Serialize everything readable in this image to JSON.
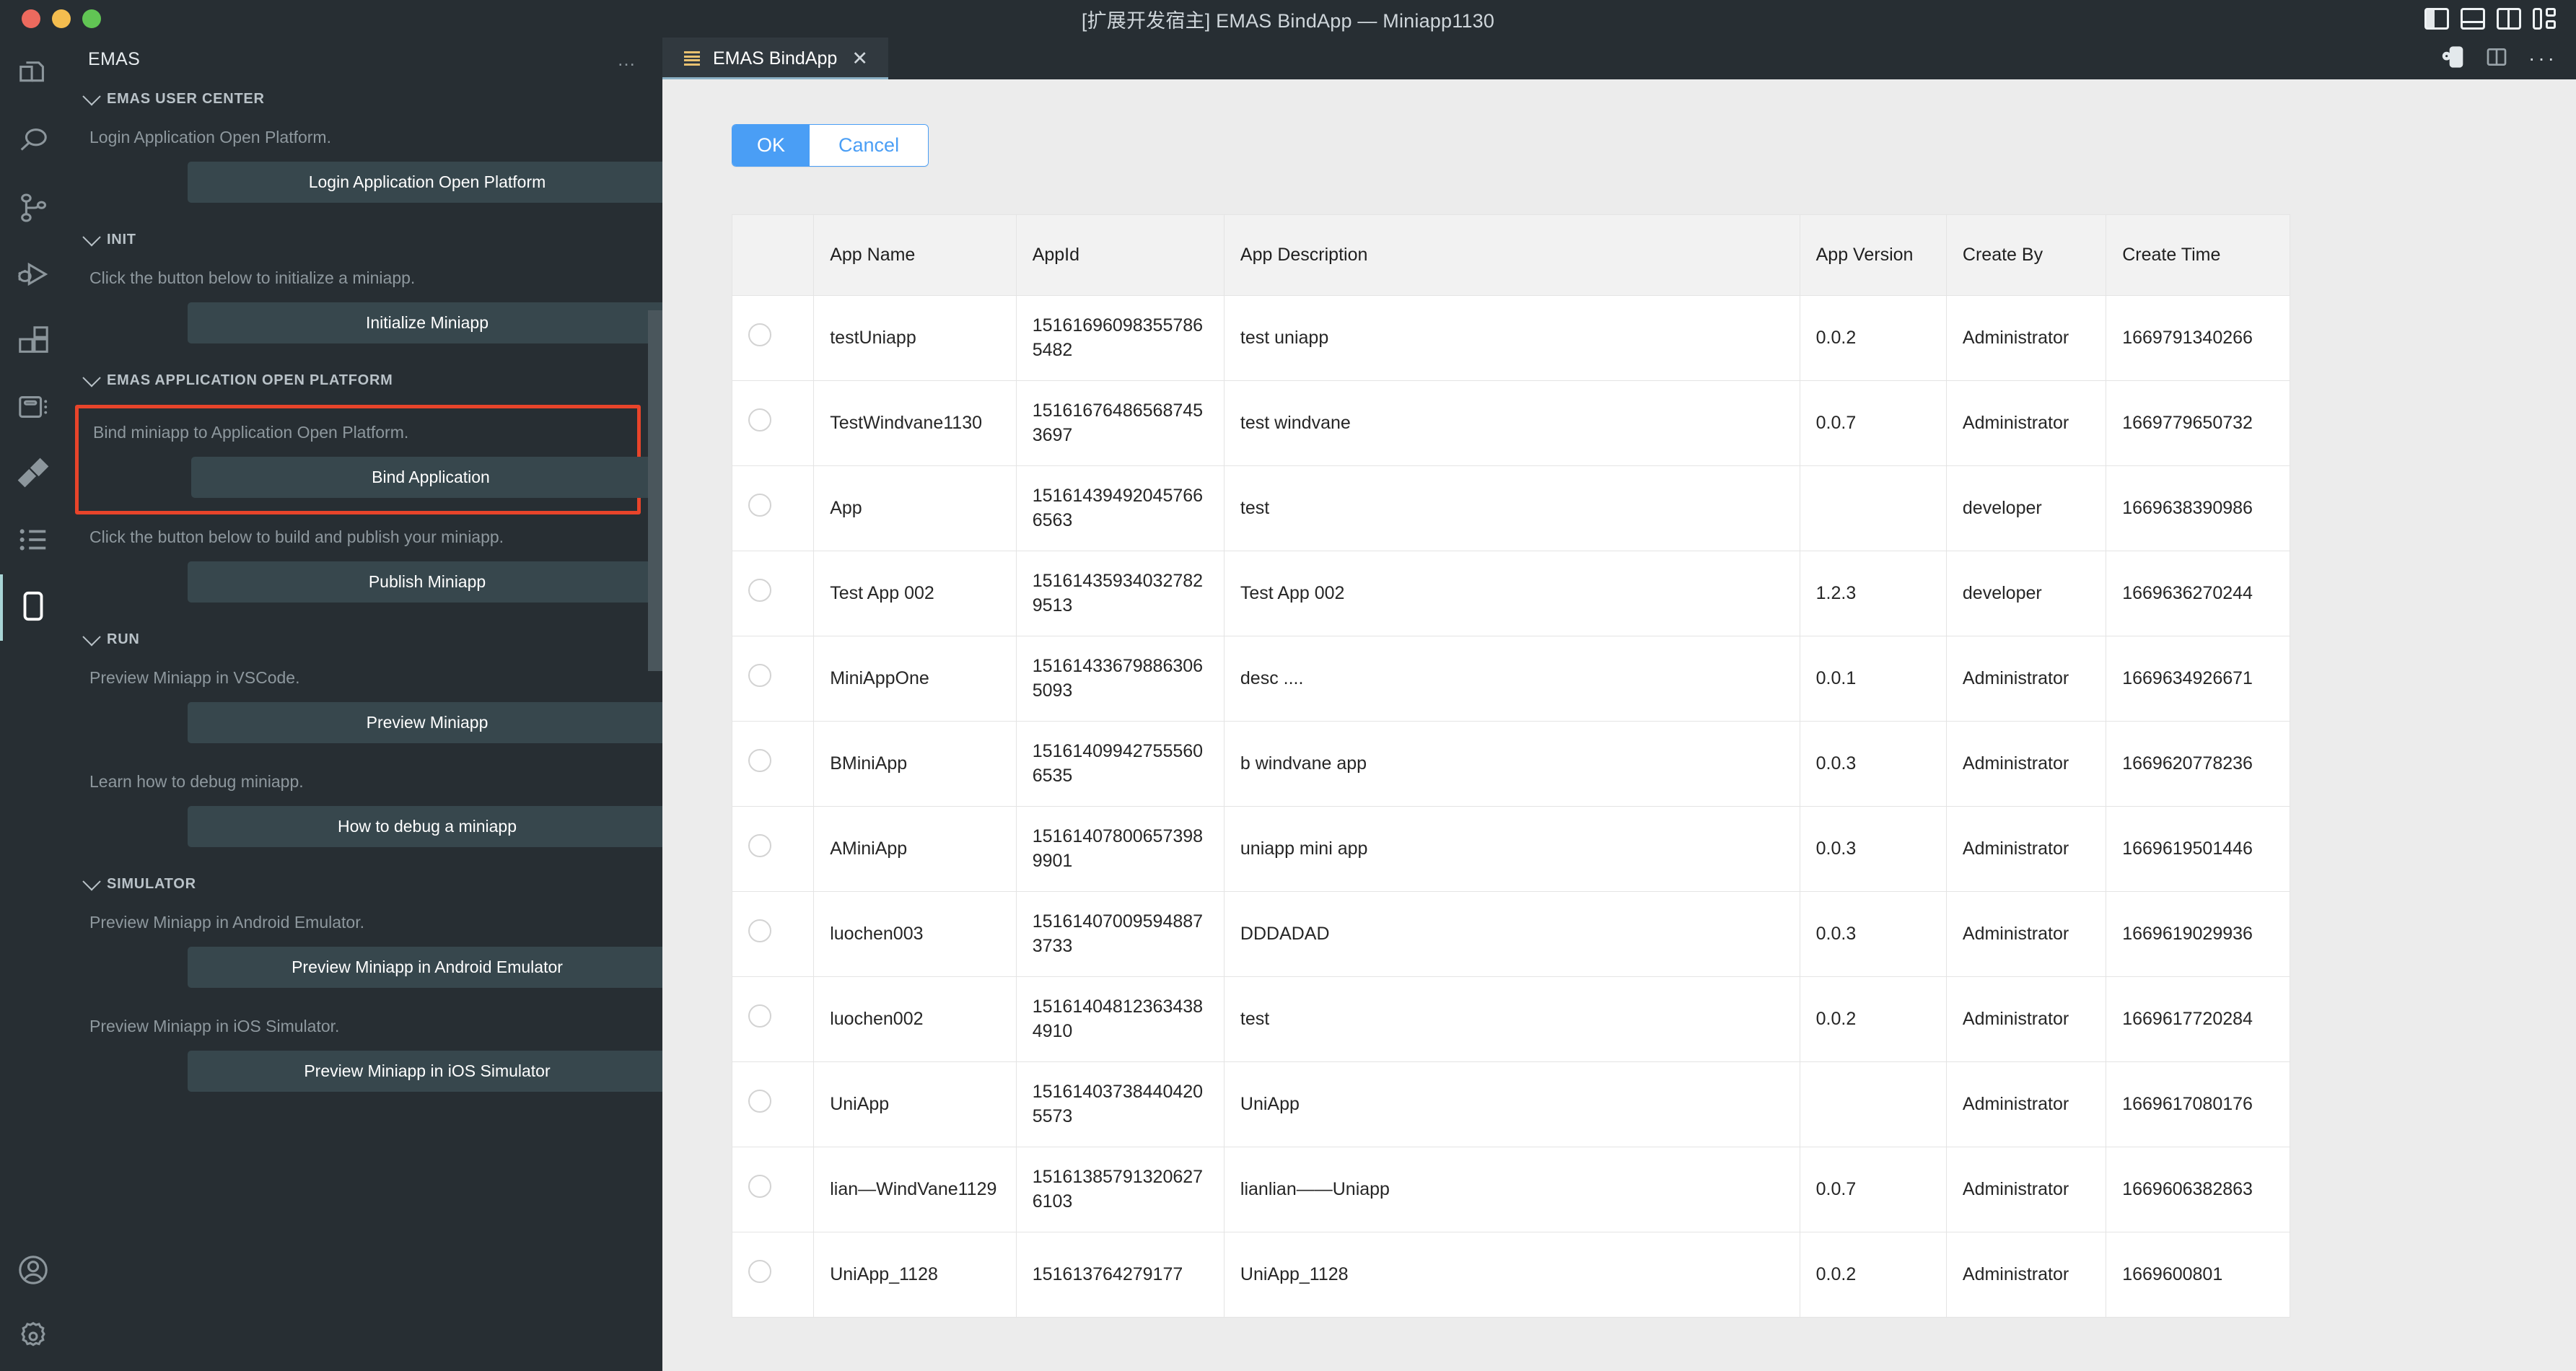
{
  "titlebar": {
    "window_title": "[扩展开发宿主] EMAS BindApp — Miniapp1130",
    "layout_icons": [
      "toggle-primary-sidebar",
      "toggle-panel",
      "toggle-secondary-sidebar",
      "customize-layout"
    ]
  },
  "activity_bar": {
    "items": [
      {
        "name": "explorer",
        "active": false
      },
      {
        "name": "search",
        "active": false
      },
      {
        "name": "source-control",
        "active": false
      },
      {
        "name": "run-and-debug",
        "active": false
      },
      {
        "name": "extensions",
        "active": false
      },
      {
        "name": "remote-explorer",
        "active": false
      },
      {
        "name": "tools",
        "active": false
      },
      {
        "name": "task-list",
        "active": false
      },
      {
        "name": "miniapp-device",
        "active": true
      }
    ],
    "bottom_items": [
      {
        "name": "accounts",
        "active": false
      },
      {
        "name": "manage-settings",
        "active": false
      }
    ]
  },
  "sidebar": {
    "title": "EMAS",
    "more_actions": "…",
    "sections": [
      {
        "header": "EMAS USER CENTER",
        "description": "Login Application Open Platform.",
        "button": "Login Application Open Platform",
        "highlighted": false
      },
      {
        "header": "INIT",
        "description": "Click the button below to initialize a miniapp.",
        "button": "Initialize Miniapp",
        "highlighted": false
      },
      {
        "header": "EMAS APPLICATION OPEN PLATFORM",
        "description": "Bind miniapp to Application Open Platform.",
        "button": "Bind Application",
        "highlighted": true,
        "highlight_color": "#e8442a",
        "extra_description": "Click the button below to build and publish your miniapp.",
        "extra_button": "Publish Miniapp"
      },
      {
        "header": "RUN",
        "description": "Preview Miniapp in VSCode.",
        "button": "Preview Miniapp",
        "highlighted": false,
        "extra_description": "Learn how to debug miniapp.",
        "extra_button": "How to debug a miniapp"
      },
      {
        "header": "SIMULATOR",
        "description": "Preview Miniapp in Android Emulator.",
        "button": "Preview Miniapp in Android Emulator",
        "highlighted": false,
        "extra_description": "Preview Miniapp in iOS Simulator.",
        "extra_button": "Preview Miniapp in iOS Simulator"
      }
    ]
  },
  "editor": {
    "tab": {
      "label": "EMAS BindApp",
      "close": "✕",
      "icon": "list-icon"
    },
    "actions": [
      "device-settings-icon",
      "split-editor-icon",
      "more-actions-icon"
    ]
  },
  "dialog": {
    "ok_label": "OK",
    "cancel_label": "Cancel",
    "accent_color": "#4a9ef5",
    "table": {
      "columns": [
        "",
        "App Name",
        "AppId",
        "App Description",
        "App Version",
        "Create By",
        "Create Time"
      ],
      "rows": [
        {
          "selected": false,
          "app_name": "testUniapp",
          "app_id": "151616960983557865482",
          "app_description": "test uniapp",
          "app_version": "0.0.2",
          "create_by": "Administrator",
          "create_time": "1669791340266"
        },
        {
          "selected": false,
          "app_name": "TestWindvane1130",
          "app_id": "151616764865687453697",
          "app_description": "test windvane",
          "app_version": "0.0.7",
          "create_by": "Administrator",
          "create_time": "1669779650732"
        },
        {
          "selected": false,
          "app_name": "App",
          "app_id": "151614394920457666563",
          "app_description": "test",
          "app_version": "",
          "create_by": "developer",
          "create_time": "1669638390986"
        },
        {
          "selected": false,
          "app_name": "Test App 002",
          "app_id": "151614359340327829513",
          "app_description": "Test App 002",
          "app_version": "1.2.3",
          "create_by": "developer",
          "create_time": "1669636270244"
        },
        {
          "selected": false,
          "app_name": "MiniAppOne",
          "app_id": "151614336798863065093",
          "app_description": "desc ....",
          "app_version": "0.0.1",
          "create_by": "Administrator",
          "create_time": "1669634926671"
        },
        {
          "selected": false,
          "app_name": "BMiniApp",
          "app_id": "151614099427555606535",
          "app_description": "b windvane app",
          "app_version": "0.0.3",
          "create_by": "Administrator",
          "create_time": "1669620778236"
        },
        {
          "selected": false,
          "app_name": "AMiniApp",
          "app_id": "151614078006573989901",
          "app_description": "uniapp mini app",
          "app_version": "0.0.3",
          "create_by": "Administrator",
          "create_time": "1669619501446"
        },
        {
          "selected": false,
          "app_name": "luochen003",
          "app_id": "151614070095948873733",
          "app_description": "DDDADAD",
          "app_version": "0.0.3",
          "create_by": "Administrator",
          "create_time": "1669619029936"
        },
        {
          "selected": false,
          "app_name": "luochen002",
          "app_id": "151614048123634384910",
          "app_description": "test",
          "app_version": "0.0.2",
          "create_by": "Administrator",
          "create_time": "1669617720284"
        },
        {
          "selected": false,
          "app_name": "UniApp",
          "app_id": "151614037384404205573",
          "app_description": "UniApp",
          "app_version": "",
          "create_by": "Administrator",
          "create_time": "1669617080176"
        },
        {
          "selected": false,
          "app_name": "lian—WindVane1129",
          "app_id": "151613857913206276103",
          "app_description": "lianlian——Uniapp",
          "app_version": "0.0.7",
          "create_by": "Administrator",
          "create_time": "1669606382863"
        },
        {
          "selected": false,
          "app_name": "UniApp_1128",
          "app_id": "151613764279177",
          "app_description": "UniApp_1128",
          "app_version": "0.0.2",
          "create_by": "Administrator",
          "create_time": "1669600801"
        }
      ]
    }
  }
}
